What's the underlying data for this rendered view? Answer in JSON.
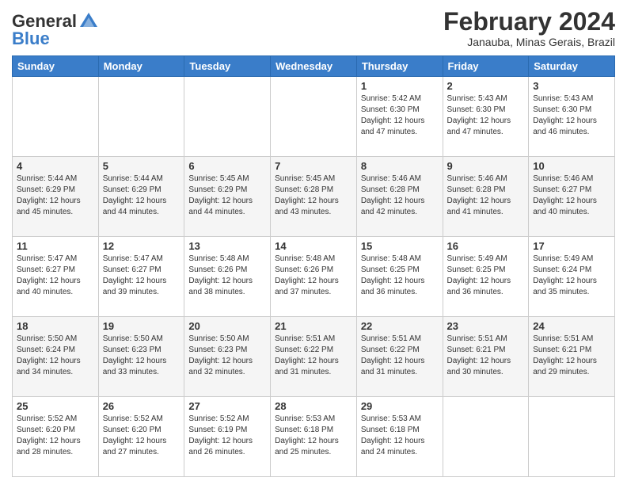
{
  "header": {
    "logo_general": "General",
    "logo_blue": "Blue",
    "title": "February 2024",
    "subtitle": "Janauba, Minas Gerais, Brazil"
  },
  "days_of_week": [
    "Sunday",
    "Monday",
    "Tuesday",
    "Wednesday",
    "Thursday",
    "Friday",
    "Saturday"
  ],
  "weeks": [
    [
      {
        "day": "",
        "info": ""
      },
      {
        "day": "",
        "info": ""
      },
      {
        "day": "",
        "info": ""
      },
      {
        "day": "",
        "info": ""
      },
      {
        "day": "1",
        "info": "Sunrise: 5:42 AM\nSunset: 6:30 PM\nDaylight: 12 hours\nand 47 minutes."
      },
      {
        "day": "2",
        "info": "Sunrise: 5:43 AM\nSunset: 6:30 PM\nDaylight: 12 hours\nand 47 minutes."
      },
      {
        "day": "3",
        "info": "Sunrise: 5:43 AM\nSunset: 6:30 PM\nDaylight: 12 hours\nand 46 minutes."
      }
    ],
    [
      {
        "day": "4",
        "info": "Sunrise: 5:44 AM\nSunset: 6:29 PM\nDaylight: 12 hours\nand 45 minutes."
      },
      {
        "day": "5",
        "info": "Sunrise: 5:44 AM\nSunset: 6:29 PM\nDaylight: 12 hours\nand 44 minutes."
      },
      {
        "day": "6",
        "info": "Sunrise: 5:45 AM\nSunset: 6:29 PM\nDaylight: 12 hours\nand 44 minutes."
      },
      {
        "day": "7",
        "info": "Sunrise: 5:45 AM\nSunset: 6:28 PM\nDaylight: 12 hours\nand 43 minutes."
      },
      {
        "day": "8",
        "info": "Sunrise: 5:46 AM\nSunset: 6:28 PM\nDaylight: 12 hours\nand 42 minutes."
      },
      {
        "day": "9",
        "info": "Sunrise: 5:46 AM\nSunset: 6:28 PM\nDaylight: 12 hours\nand 41 minutes."
      },
      {
        "day": "10",
        "info": "Sunrise: 5:46 AM\nSunset: 6:27 PM\nDaylight: 12 hours\nand 40 minutes."
      }
    ],
    [
      {
        "day": "11",
        "info": "Sunrise: 5:47 AM\nSunset: 6:27 PM\nDaylight: 12 hours\nand 40 minutes."
      },
      {
        "day": "12",
        "info": "Sunrise: 5:47 AM\nSunset: 6:27 PM\nDaylight: 12 hours\nand 39 minutes."
      },
      {
        "day": "13",
        "info": "Sunrise: 5:48 AM\nSunset: 6:26 PM\nDaylight: 12 hours\nand 38 minutes."
      },
      {
        "day": "14",
        "info": "Sunrise: 5:48 AM\nSunset: 6:26 PM\nDaylight: 12 hours\nand 37 minutes."
      },
      {
        "day": "15",
        "info": "Sunrise: 5:48 AM\nSunset: 6:25 PM\nDaylight: 12 hours\nand 36 minutes."
      },
      {
        "day": "16",
        "info": "Sunrise: 5:49 AM\nSunset: 6:25 PM\nDaylight: 12 hours\nand 36 minutes."
      },
      {
        "day": "17",
        "info": "Sunrise: 5:49 AM\nSunset: 6:24 PM\nDaylight: 12 hours\nand 35 minutes."
      }
    ],
    [
      {
        "day": "18",
        "info": "Sunrise: 5:50 AM\nSunset: 6:24 PM\nDaylight: 12 hours\nand 34 minutes."
      },
      {
        "day": "19",
        "info": "Sunrise: 5:50 AM\nSunset: 6:23 PM\nDaylight: 12 hours\nand 33 minutes."
      },
      {
        "day": "20",
        "info": "Sunrise: 5:50 AM\nSunset: 6:23 PM\nDaylight: 12 hours\nand 32 minutes."
      },
      {
        "day": "21",
        "info": "Sunrise: 5:51 AM\nSunset: 6:22 PM\nDaylight: 12 hours\nand 31 minutes."
      },
      {
        "day": "22",
        "info": "Sunrise: 5:51 AM\nSunset: 6:22 PM\nDaylight: 12 hours\nand 31 minutes."
      },
      {
        "day": "23",
        "info": "Sunrise: 5:51 AM\nSunset: 6:21 PM\nDaylight: 12 hours\nand 30 minutes."
      },
      {
        "day": "24",
        "info": "Sunrise: 5:51 AM\nSunset: 6:21 PM\nDaylight: 12 hours\nand 29 minutes."
      }
    ],
    [
      {
        "day": "25",
        "info": "Sunrise: 5:52 AM\nSunset: 6:20 PM\nDaylight: 12 hours\nand 28 minutes."
      },
      {
        "day": "26",
        "info": "Sunrise: 5:52 AM\nSunset: 6:20 PM\nDaylight: 12 hours\nand 27 minutes."
      },
      {
        "day": "27",
        "info": "Sunrise: 5:52 AM\nSunset: 6:19 PM\nDaylight: 12 hours\nand 26 minutes."
      },
      {
        "day": "28",
        "info": "Sunrise: 5:53 AM\nSunset: 6:18 PM\nDaylight: 12 hours\nand 25 minutes."
      },
      {
        "day": "29",
        "info": "Sunrise: 5:53 AM\nSunset: 6:18 PM\nDaylight: 12 hours\nand 24 minutes."
      },
      {
        "day": "",
        "info": ""
      },
      {
        "day": "",
        "info": ""
      }
    ]
  ]
}
